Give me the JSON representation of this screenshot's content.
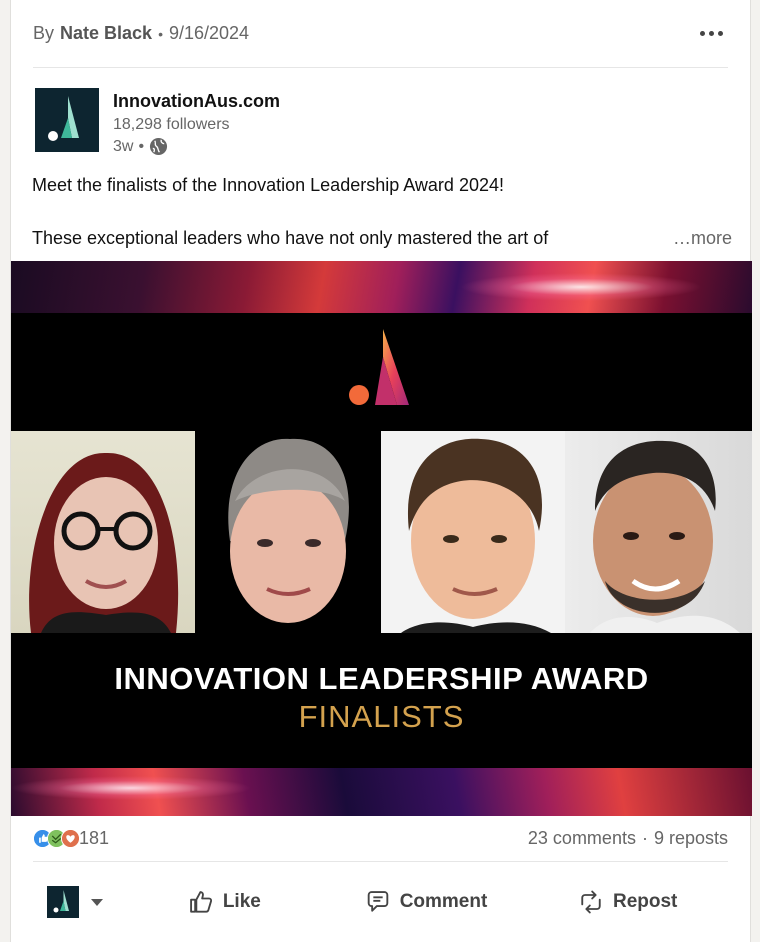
{
  "byline": {
    "prefix": "By",
    "author": "Nate Black",
    "separator": "•",
    "date": "9/16/2024"
  },
  "actor": {
    "name": "InnovationAus.com",
    "followers": "18,298 followers",
    "time": "3w",
    "time_separator": "•"
  },
  "post": {
    "line1": "Meet the finalists of the Innovation Leadership Award 2024!",
    "line2": "These exceptional leaders who have not only mastered the art of",
    "see_more": "…more"
  },
  "image": {
    "title": "INNOVATION LEADERSHIP AWARD",
    "subtitle": "FINALISTS"
  },
  "social": {
    "reactions_count": "181",
    "comments": "23 comments",
    "separator": "·",
    "reposts": "9 reposts"
  },
  "actions": {
    "like": "Like",
    "comment": "Comment",
    "repost": "Repost"
  },
  "colors": {
    "brand_dark": "#0d2530",
    "brand_teal": "#3fb89a",
    "award_gold": "#d4a24e",
    "like_blue": "#378fe9",
    "support_green": "#7fc15e",
    "love_red": "#df704d"
  },
  "icons": [
    "more-icon",
    "globe-icon",
    "like-icon",
    "comment-icon",
    "repost-icon",
    "caret-down-icon"
  ]
}
